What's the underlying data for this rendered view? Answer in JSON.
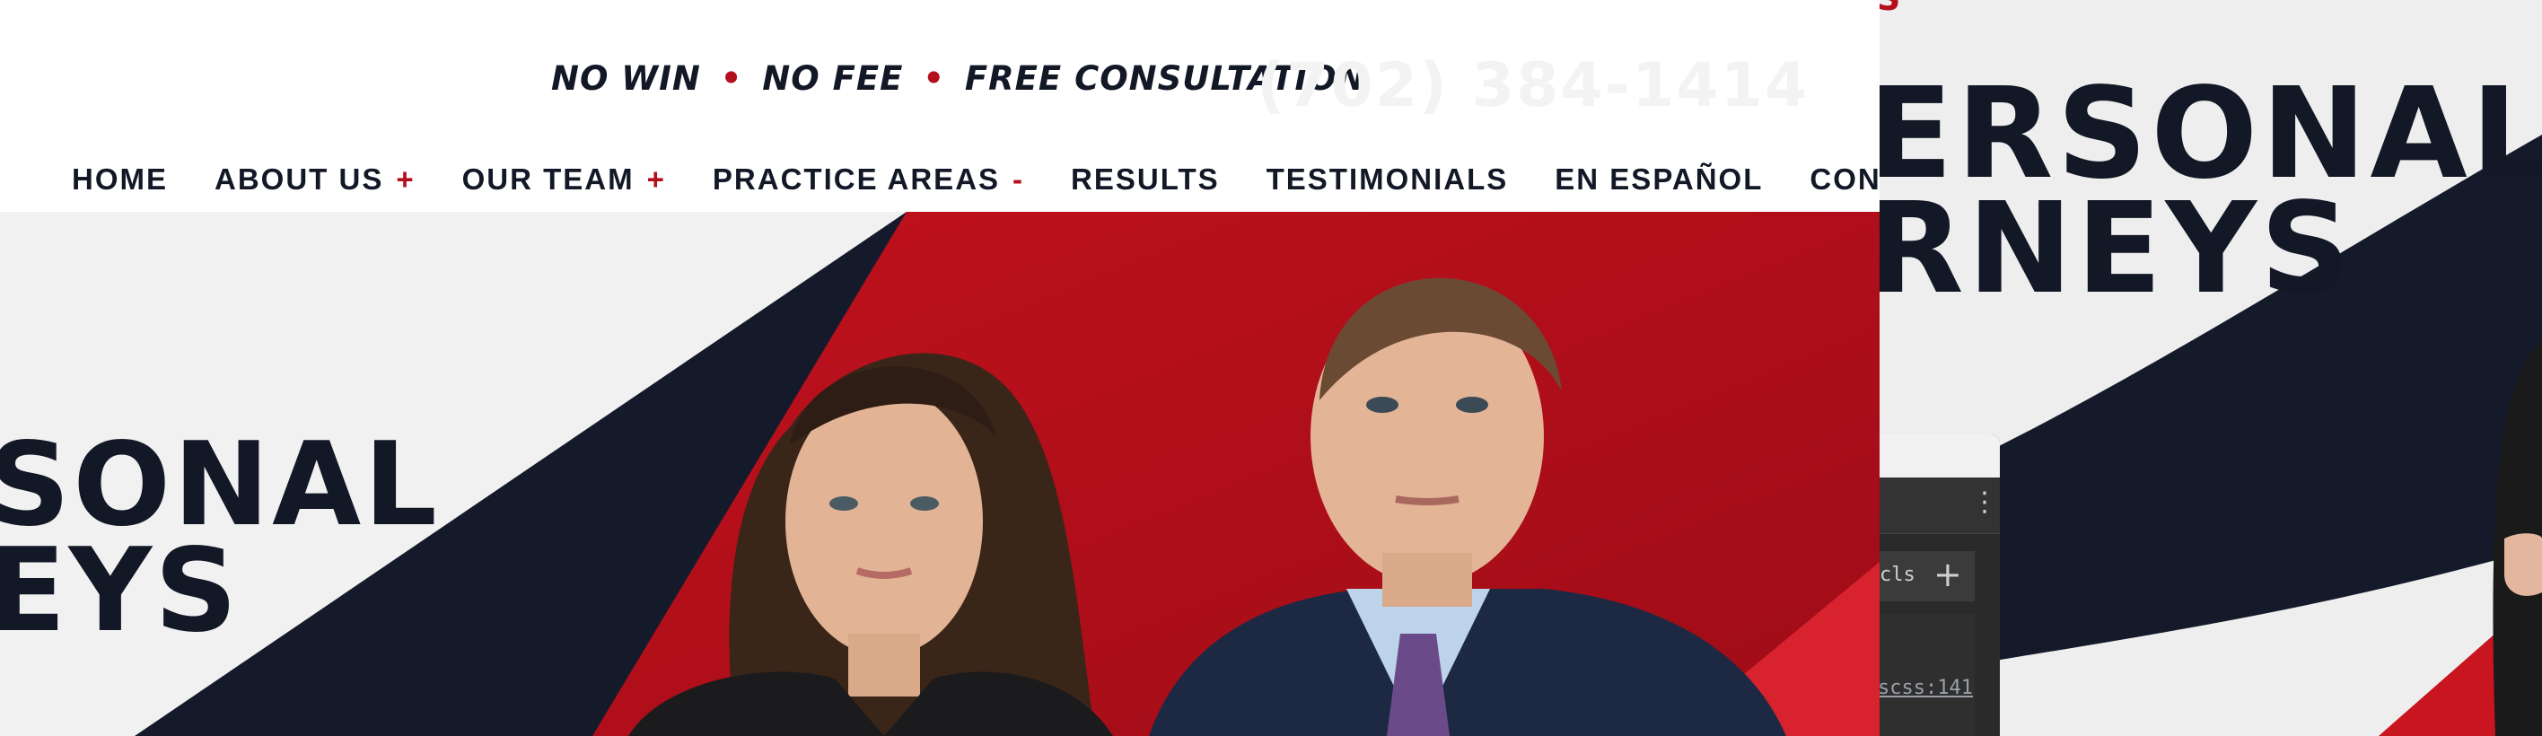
{
  "header": {
    "tagline": {
      "part1": "NO WIN",
      "part2": "NO FEE",
      "part3": "FREE CONSULTATION",
      "separator": "•"
    },
    "phone": "(702) 384-1414"
  },
  "nav": {
    "items": [
      {
        "label": "HOME",
        "toggle": ""
      },
      {
        "label": "ABOUT US",
        "toggle": "+"
      },
      {
        "label": "OUR TEAM",
        "toggle": "+"
      },
      {
        "label": "PRACTICE AREAS",
        "toggle": "-"
      },
      {
        "label": "RESULTS",
        "toggle": ""
      },
      {
        "label": "TESTIMONIALS",
        "toggle": ""
      },
      {
        "label": "EN ESPAÑOL",
        "toggle": ""
      },
      {
        "label": "CONTACT",
        "toggle": ""
      }
    ]
  },
  "hero": {
    "title_line1": "SONAL",
    "title_line2": "EYS"
  },
  "background_window": {
    "red_fragment": "S",
    "title_line1": "ERSONAL",
    "title_line2": "RNEYS"
  },
  "devtools": {
    "menu_icon": "kebab-menu-icon",
    "cls_label": "cls",
    "add_label": "+",
    "source_link": "scss:141"
  },
  "colors": {
    "navy": "#121826",
    "brand_red": "#b30f1c",
    "bright_red": "#d8232f",
    "light_gray": "#f1f1f1"
  }
}
